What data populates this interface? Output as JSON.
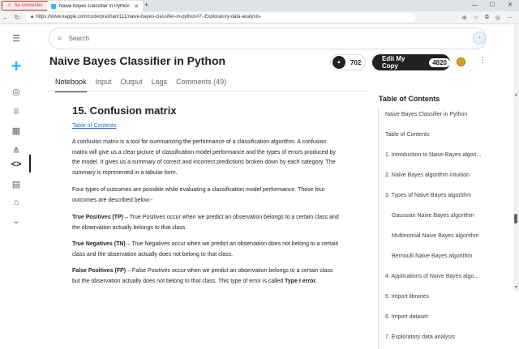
{
  "browser": {
    "security_alert": "Se connecter",
    "tab_title": "Naive Bayes Classifier in Python",
    "url": "https://www.kaggle.com/code/prashant111/naive-bayes-classifier-in-python#7.-Exploratory-data-analysis-"
  },
  "search": {
    "placeholder": "Search"
  },
  "notebook": {
    "title": "Naive Bayes Classifier in Python",
    "upvotes": "702",
    "edit_copy_label": "Edit My Copy",
    "copies_count": "4820",
    "tabs": [
      {
        "label": "Notebook"
      },
      {
        "label": "Input"
      },
      {
        "label": "Output"
      },
      {
        "label": "Logs"
      },
      {
        "label": "Comments (49)"
      }
    ]
  },
  "content": {
    "section_title": "15. Confusion matrix",
    "toc_link": "Table of Contents",
    "p1": "A confusion matrix is a tool for summarizing the performance of a classification algorithm. A confusion matrix will give us a clear picture of classification model performance and the types of errors produced by the model. It gives us a summary of correct and incorrect predictions broken down by each category. The summary is represented in a tabular form.",
    "p2": "Four types of outcomes are possible while evaluating a classification model performance. These four outcomes are described below:-",
    "tp_label": "True Positives (TP)",
    "tp_text": " – True Positives occur when we predict an observation belongs to a certain class and the observation actually belongs to that class.",
    "tn_label": "True Negatives (TN)",
    "tn_text": " – True Negatives occur when we predict an observation does not belong to a certain class and the observation actually does not belong to that class.",
    "fp_label": "False Positives (FP)",
    "fp_text": " – False Positives occur when we predict an observation belongs to a certain class but the observation actually does not belong to that class. This type of error is called ",
    "fp_error": "Type I error."
  },
  "toc": {
    "title": "Table of Contents",
    "items": [
      {
        "label": "Naive Bayes Classifier in Python",
        "level": 1
      },
      {
        "label": "Table of Contents",
        "level": 1
      },
      {
        "label": "1. Introduction to Naive Bayes algori...",
        "level": 1
      },
      {
        "label": "2. Naive Bayes algorithm intuition",
        "level": 1
      },
      {
        "label": "3. Types of Naive Bayes algorithm",
        "level": 1
      },
      {
        "label": "Gaussian Naive Bayes algorithm",
        "level": 2
      },
      {
        "label": "Multinomial Naive Bayes algorithm",
        "level": 2
      },
      {
        "label": "Bernoulli Naive Bayes algorithm",
        "level": 2
      },
      {
        "label": "4. Applications of Naive Bayes algo...",
        "level": 1
      },
      {
        "label": "5. Import libraries",
        "level": 1
      },
      {
        "label": "6. Import dataset",
        "level": 1
      },
      {
        "label": "7. Exploratory data analysis",
        "level": 1
      }
    ]
  },
  "colors": {
    "accent": "#20beff",
    "link": "#1a73e8",
    "dark_button": "#202124",
    "alert": "#c0392b"
  },
  "icons": {
    "nav": [
      "menu-icon",
      "plus-icon",
      "compass-icon",
      "trophy-icon",
      "table-icon",
      "hierarchy-icon",
      "code-icon",
      "comments-icon",
      "school-icon",
      "chevron-down-icon"
    ]
  }
}
